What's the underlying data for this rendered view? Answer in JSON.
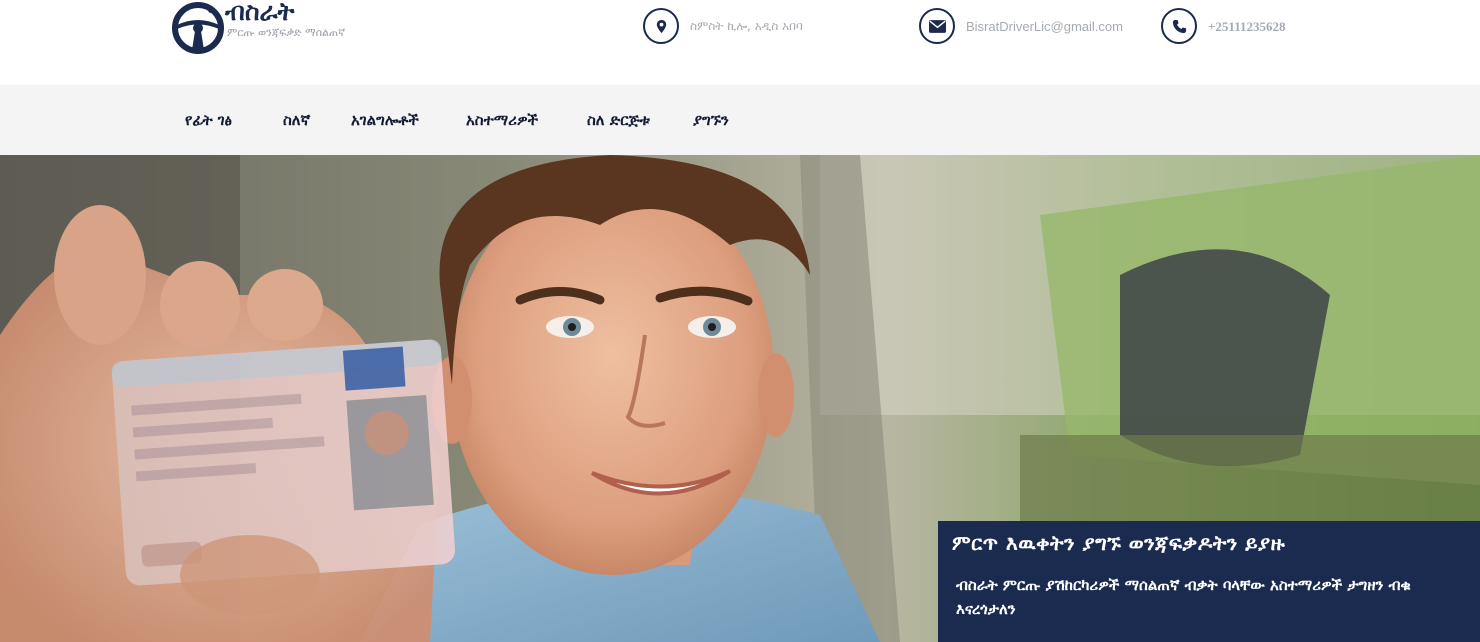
{
  "brand": {
    "name": "ብስራት",
    "tagline": "ምርጡ ወንጃፍቃድ ማሰልጠኛ"
  },
  "contacts": {
    "address": {
      "icon": "map-pin-icon",
      "text": "ስምስት ኪሎ, አዲስ አበባ"
    },
    "email": {
      "icon": "envelope-icon",
      "text": "BisratDriverLic@gmail.com"
    },
    "phone": {
      "icon": "phone-icon",
      "text": "+25111235628"
    }
  },
  "nav": {
    "items": [
      {
        "label": "የፊት ገፅ"
      },
      {
        "label": "ስለኛ"
      },
      {
        "label": "አገልግሎቶች"
      },
      {
        "label": "አስተማሪዎች"
      },
      {
        "label": "ስለ ድርጅቱ"
      },
      {
        "label": "ያግኙን"
      }
    ]
  },
  "hero": {
    "title": "ምርጥ እዉቀትን ያግኙ ወንጃፍቃዶትን ይያዙ",
    "text": "ብስራት ምርጡ ያሽከርካሪዎች ማሰልጠኛ ብቃት ባላቸው አስተማሪዎች ታግዘን ብቁ እናረጎታለን"
  },
  "colors": {
    "brand_navy": "#1c2a4f",
    "caption_bg": "#1b2b4f",
    "nav_bg": "#f4f4f4",
    "muted_text": "#a6abb3"
  }
}
